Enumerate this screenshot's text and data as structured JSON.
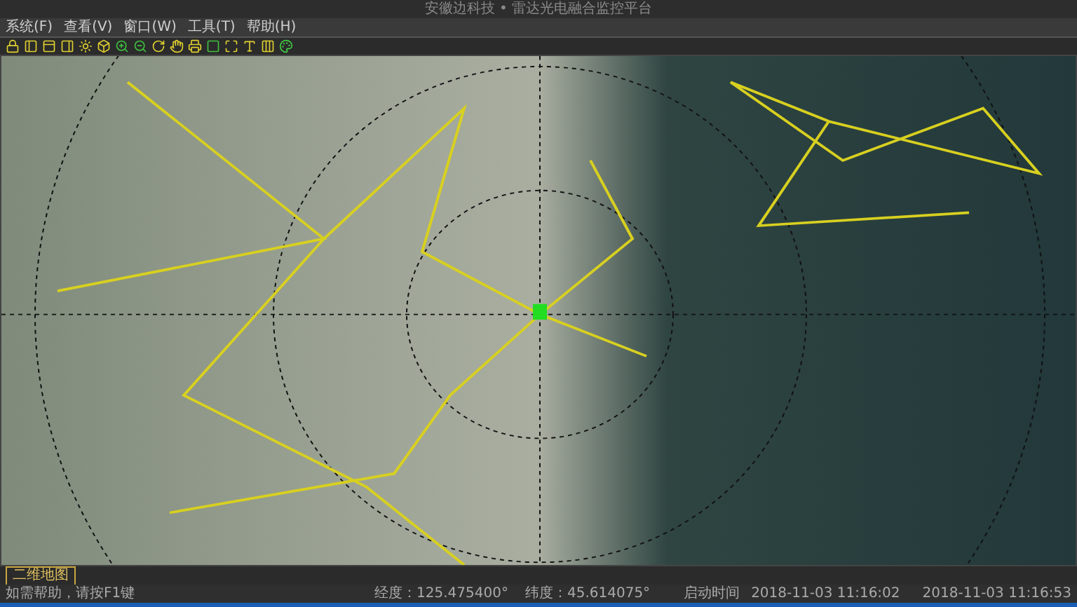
{
  "window": {
    "title": "安徽边科技 • 雷达光电融合监控平台"
  },
  "menu": [
    "系统(F)",
    "查看(V)",
    "窗口(W)",
    "工具(T)",
    "帮助(H)"
  ],
  "map_tabs": [
    {
      "label": "二维地图",
      "selected": true
    }
  ],
  "status_bar": {
    "hint": "如需帮助，请按F1键",
    "longitude": "经度：125.475400°",
    "latitude": "纬度：45.614075°",
    "start_label": "启动时间",
    "start_time": "2018-11-03 11:16:02",
    "current_time": "2018-11-03 11:16:53"
  }
}
